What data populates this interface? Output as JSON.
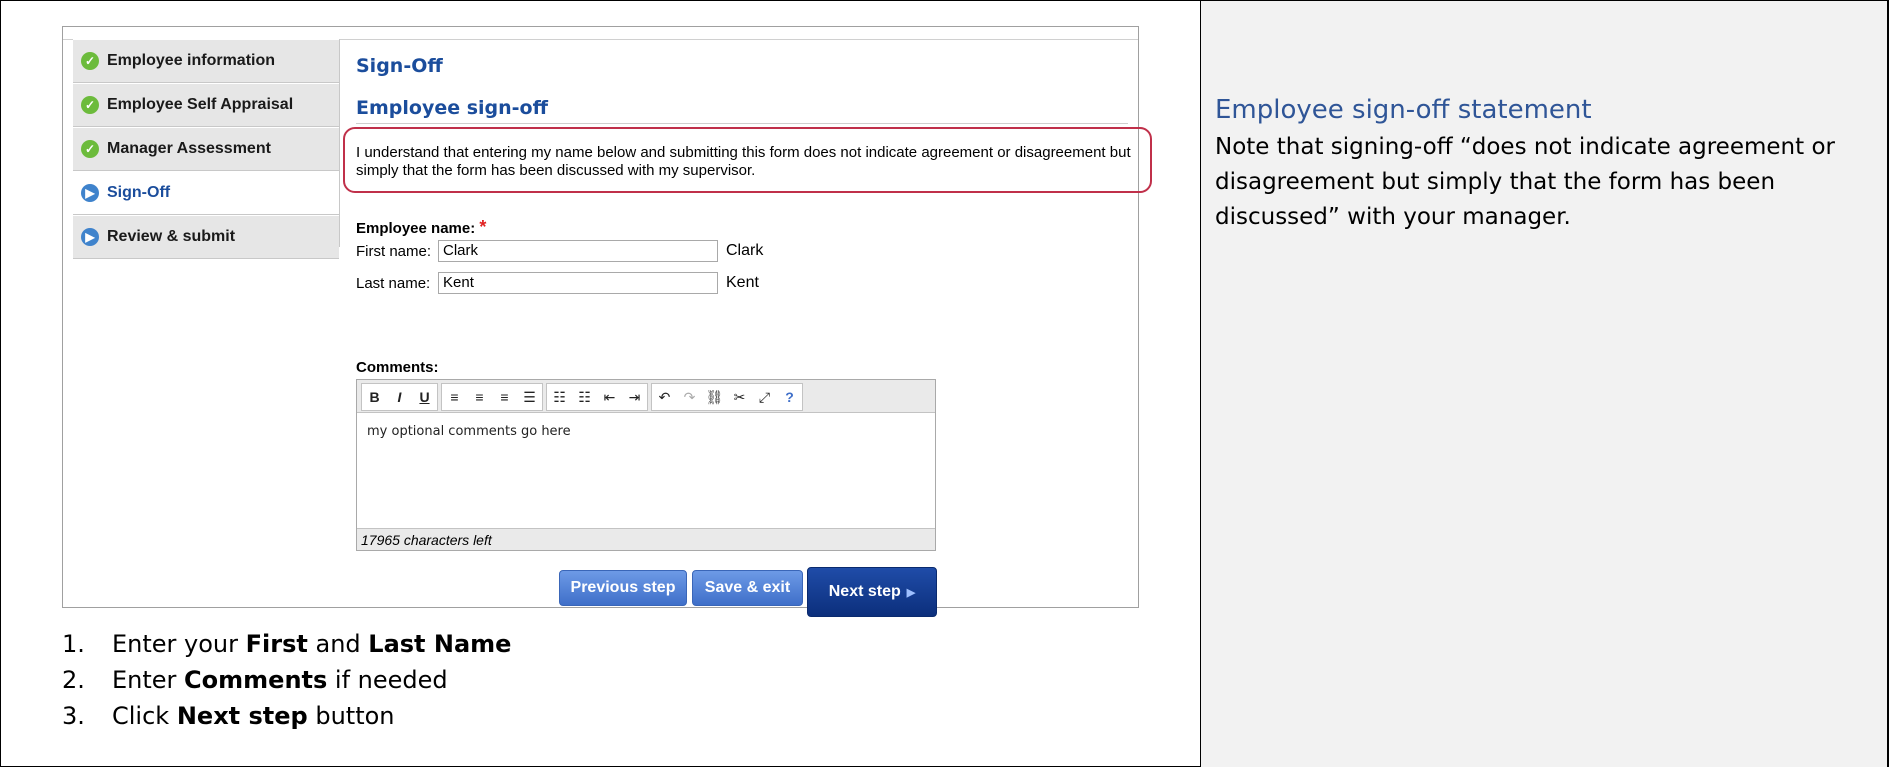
{
  "nav": {
    "items": [
      {
        "label": "Employee information",
        "state": "done"
      },
      {
        "label": "Employee Self Appraisal",
        "state": "done"
      },
      {
        "label": "Manager Assessment",
        "state": "done"
      },
      {
        "label": "Sign-Off",
        "state": "active"
      },
      {
        "label": "Review & submit",
        "state": "todo"
      }
    ]
  },
  "main": {
    "section_title": "Sign-Off",
    "subsection_title": "Employee sign-off",
    "statement": "I understand that entering my name below and submitting this form does not indicate agreement or disagreement but simply that the form has been discussed with my supervisor.",
    "employee_name_label": "Employee name:",
    "required_mark": "*",
    "first_name_label": "First name:",
    "first_name_value": "Clark",
    "first_name_echo": "Clark",
    "last_name_label": "Last name:",
    "last_name_value": "Kent",
    "last_name_echo": "Kent",
    "comments_label": "Comments:",
    "comments_value": "my optional comments go here",
    "chars_left": "17965 characters left",
    "toolbar": [
      "bold",
      "italic",
      "underline",
      "align-left",
      "align-center",
      "align-right",
      "align-justify",
      "bullet-list",
      "numbered-list",
      "outdent",
      "indent",
      "undo",
      "redo",
      "link",
      "unlink",
      "fullscreen",
      "help"
    ],
    "buttons": {
      "previous": "Previous step",
      "save": "Save & exit",
      "next": "Next step"
    }
  },
  "instructions": [
    {
      "num": "1.",
      "pre": "Enter your ",
      "b1": "First",
      "mid": " and ",
      "b2": "Last Name",
      "post": ""
    },
    {
      "num": "2.",
      "pre": "Enter ",
      "b1": "Comments",
      "mid": " if needed",
      "b2": "",
      "post": ""
    },
    {
      "num": "3.",
      "pre": "Click ",
      "b1": "Next step",
      "mid": " button",
      "b2": "",
      "post": ""
    }
  ],
  "side": {
    "title": "Employee sign-off statement",
    "body": "Note that signing-off “does not indicate agreement or disagreement but simply that the form has been discussed” with your manager."
  },
  "colors": {
    "accent": "#1b4d9c",
    "done": "#6cbb3c",
    "todo": "#3f83cc",
    "highlight": "#c0304a",
    "button": "#3f6fc9",
    "button_primary": "#0c2f7c"
  }
}
